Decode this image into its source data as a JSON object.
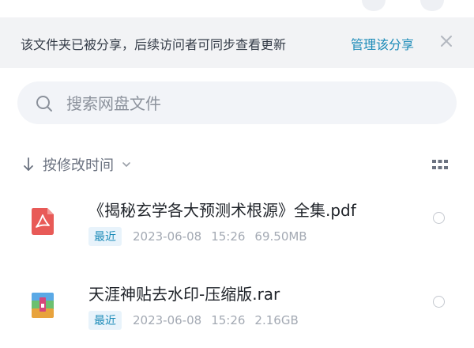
{
  "banner": {
    "message": "该文件夹已被分享，后续访问者可同步查看更新",
    "action_label": "管理该分享",
    "close_glyph": "×"
  },
  "search": {
    "placeholder": "搜索网盘文件",
    "icon": "search-icon"
  },
  "sort": {
    "label": "按修改时间",
    "arrow_icon": "arrow-down-icon",
    "dropdown_icon": "chevron-down-icon"
  },
  "view_toggle": {
    "icon": "grid-view-icon"
  },
  "files": [
    {
      "name": "《揭秘玄学各大预测术根源》全集.pdf",
      "badge": "最近",
      "date": "2023-06-08",
      "time": "15:26",
      "size": "69.50MB",
      "icon": "pdf-file-icon"
    },
    {
      "name": "天涯神贴去水印-压缩版.rar",
      "badge": "最近",
      "date": "2023-06-08",
      "time": "15:26",
      "size": "2.16GB",
      "icon": "archive-file-icon"
    }
  ],
  "colors": {
    "accent": "#1c8bb8",
    "banner_bg": "#f2f3f5",
    "search_bg": "#f2f4f8",
    "pdf_red": "#e85a57"
  }
}
